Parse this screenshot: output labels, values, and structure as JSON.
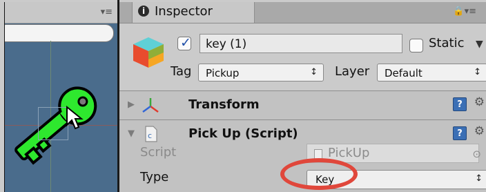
{
  "inspector": {
    "tab_label": "Inspector",
    "tab_menu_glyph": "▾≡",
    "lock_glyph": "🔒▾≡"
  },
  "scene": {
    "menu_glyph": "▾≡"
  },
  "gameobject": {
    "active_checked": true,
    "name_value": "key (1)",
    "static_label": "Static",
    "static_checked": false,
    "tag_label": "Tag",
    "tag_value": "Pickup",
    "layer_label": "Layer",
    "layer_value": "Default",
    "dropdown_arrow": "↕"
  },
  "components": {
    "transform_title": "Transform",
    "pickup_title": "Pick Up (Script)",
    "help_glyph": "?",
    "gear_glyph": "⚙",
    "foldout_collapsed": "▶",
    "foldout_expanded": "▼"
  },
  "properties": {
    "script_label": "Script",
    "script_value": "PickUp",
    "target_glyph": "⊙",
    "type_label": "Type",
    "type_value": "Key"
  },
  "colors": {
    "key_fill": "#2ee82e",
    "highlight": "#e0473b",
    "scene_bg": "#4a6c8c"
  }
}
